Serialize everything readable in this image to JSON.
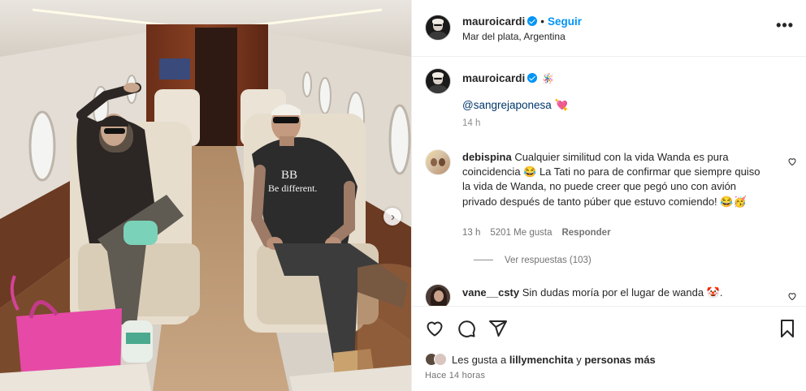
{
  "header": {
    "username": "mauroicardi",
    "separator": "•",
    "follow_label": "Seguir",
    "location": "Mar del plata, Argentina",
    "more_label": "•••"
  },
  "caption": {
    "username": "mauroicardi",
    "emoji": "🪅",
    "mention": "@sangrejaponesa",
    "heart": "💘",
    "time": "14 h"
  },
  "comments": [
    {
      "username": "debispina",
      "text": "Cualquier similitud con la vida Wanda es pura coincidencia 😂 La Tati no para de confirmar que siempre quiso la vida de Wanda, no puede creer que pegó uno con avión privado después de tanto púber que estuvo comiendo! 😂🥳",
      "time": "13 h",
      "likes": "5201 Me gusta",
      "reply_label": "Responder",
      "view_replies": "Ver respuestas (103)"
    },
    {
      "username": "vane__csty",
      "text": "Sin dudas moría por el lugar de wanda 🤡."
    }
  ],
  "likes": {
    "prefix": "Les gusta a",
    "user": "lillymenchita",
    "connector": "y",
    "rest": "personas más"
  },
  "time_ago": "Hace 14 horas",
  "colors": {
    "link_blue": "#0095f6",
    "mention_blue": "#00376b",
    "muted": "#737373",
    "border": "#efefef"
  },
  "icons": [
    "verified-badge-icon",
    "more-options-icon",
    "heart-icon",
    "comment-icon",
    "share-icon",
    "save-icon",
    "next-arrow-icon"
  ]
}
